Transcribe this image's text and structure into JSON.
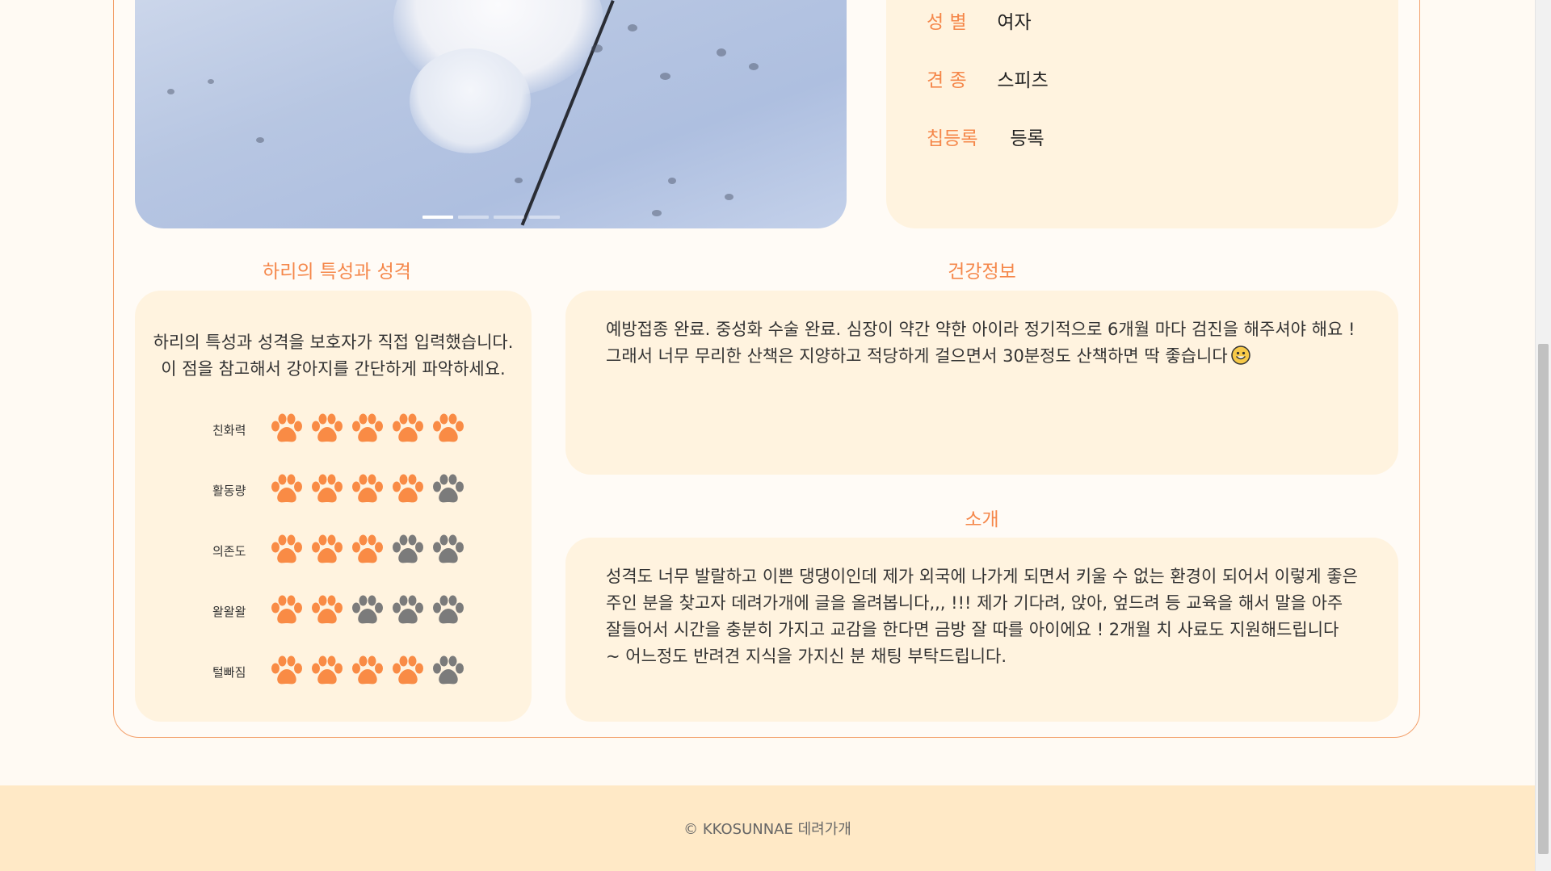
{
  "info": {
    "rows": [
      {
        "label": "성 별",
        "value": "여자"
      },
      {
        "label": "견 종",
        "value": "스피츠"
      },
      {
        "label": "칩등록",
        "value": "등록"
      }
    ]
  },
  "traits": {
    "title": "하리의 특성과 성격",
    "description_line1": "하리의 특성과 성격을 보호자가 직접 입력했습니다.",
    "description_line2": "이 점을 참고해서 강아지를 간단하게 파악하세요.",
    "max_rating": 5,
    "items": [
      {
        "label": "친화력",
        "rating": 5
      },
      {
        "label": "활동량",
        "rating": 4
      },
      {
        "label": "의존도",
        "rating": 3
      },
      {
        "label": "왈왈왈",
        "rating": 2
      },
      {
        "label": "털빠짐",
        "rating": 4
      }
    ]
  },
  "health": {
    "title": "건강정보",
    "line1": "예방접종 완료. 중성화 수술 완료. 심장이 약간 약한 아이라 정기적으로 6개월 마다 검진을 해주셔야 해요 !",
    "line2": "그래서 너무 무리한 산책은 지양하고 적당하게 걸으면서 30분정도 산책하면 딱 좋습니다"
  },
  "intro": {
    "title": "소개",
    "text": "성격도 너무 발랄하고 이쁜 댕댕이인데 제가 외국에 나가게 되면서 키울 수 없는 환경이 되어서 이렇게 좋은 주인 분을 찾고자 데려가개에 글을 올려봅니다,,, !!! 제가 기다려, 앉아, 엎드려 등 교육을 해서 말을 아주 잘들어서 시간을 충분히 가지고 교감을 한다면 금방 잘 따를 아이에요 ! 2개월 치 사료도 지원해드립니다 ~ 어느정도 반려견 지식을 가지신 분 채팅 부탁드립니다."
  },
  "carousel": {
    "slide_count": 4,
    "active_index": 0
  },
  "footer": {
    "text": "© KKOSUNNAE 데려가개"
  },
  "colors": {
    "accent": "#f5874a",
    "paw_active": "#f98b45",
    "paw_inactive": "#7b7b7b",
    "panel_bg": "#fff3df",
    "footer_bg": "#ffe9c6"
  }
}
